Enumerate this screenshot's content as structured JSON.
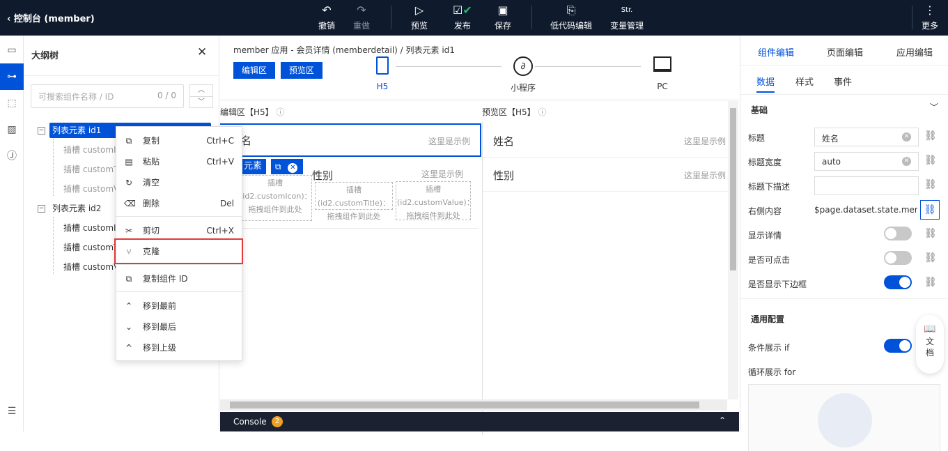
{
  "topbar": {
    "back_label": "控制台 (member)",
    "actions": [
      {
        "label": "撤销",
        "icon": "↶"
      },
      {
        "label": "重做",
        "icon": "↷"
      },
      {
        "label": "预览",
        "icon": "▷"
      },
      {
        "label": "发布",
        "icon": "☑"
      },
      {
        "label": "保存",
        "icon": "💾"
      },
      {
        "label": "低代码编辑",
        "icon": "⎘"
      },
      {
        "label": "变量管理",
        "icon": "Str."
      },
      {
        "label": "更多",
        "icon": "⋮"
      }
    ]
  },
  "outline": {
    "title": "大纲树",
    "search_placeholder": "可搜索组件名称 / ID",
    "search_count": "0 / 0",
    "nodes": [
      {
        "label": "列表元素 id1",
        "children": [
          "插槽 customIc",
          "插槽 customTi",
          "插槽 customVa"
        ]
      },
      {
        "label": "列表元素 id2",
        "children": [
          "插槽 customIc",
          "插槽 customTi",
          "插槽 customVa"
        ]
      }
    ]
  },
  "context_menu": {
    "items": [
      {
        "label": "复制",
        "shortcut": "Ctrl+C",
        "icon": "⧉"
      },
      {
        "label": "粘贴",
        "shortcut": "Ctrl+V",
        "icon": "📋"
      },
      {
        "label": "清空",
        "shortcut": "",
        "icon": "↻"
      },
      {
        "label": "删除",
        "shortcut": "Del",
        "icon": "⌫"
      },
      {
        "label": "剪切",
        "shortcut": "Ctrl+X",
        "icon": "✂"
      },
      {
        "label": "克隆",
        "shortcut": "",
        "icon": "⑂"
      },
      {
        "label": "复制组件 ID",
        "shortcut": "",
        "icon": "⧉"
      },
      {
        "label": "移到最前",
        "shortcut": "",
        "icon": "⌃"
      },
      {
        "label": "移到最后",
        "shortcut": "",
        "icon": "⌄"
      },
      {
        "label": "移到上级",
        "shortcut": "",
        "icon": "^"
      }
    ]
  },
  "center": {
    "breadcrumb": "member 应用 - 会员详情 (memberdetail)   /   列表元素 id1",
    "edit_btn": "编辑区",
    "preview_btn": "预览区",
    "devices": [
      "H5",
      "小程序",
      "PC"
    ],
    "edit_area_title": "编辑区【H5】",
    "preview_area_title": "预览区【H5】",
    "edit_row1_label": "名",
    "edit_row1_hint": "这里是示例",
    "edit_row2_label": "性别",
    "edit_row2_hint": "这里是示例",
    "selected_tag": "元素",
    "slot1": "插槽 (id2.customIcon)：拖拽组件到此处",
    "slot2": "插槽(id2.customTitle)：拖拽组件到此处",
    "slot3": "插槽 (id2.customValue)：拖拽组件到此处",
    "preview_row1_label": "姓名",
    "preview_row1_hint": "这里是示例",
    "preview_row2_label": "性别",
    "preview_row2_hint": "这里是示例",
    "console_label": "Console",
    "console_badge": "2"
  },
  "right": {
    "tabs": [
      "组件编辑",
      "页面编辑",
      "应用编辑"
    ],
    "subtabs": [
      "数据",
      "样式",
      "事件"
    ],
    "section_basic": "基础",
    "props": [
      {
        "label": "标题",
        "value": "姓名"
      },
      {
        "label": "标题宽度",
        "value": "auto"
      },
      {
        "label": "标题下描述",
        "value": ""
      },
      {
        "label": "右侧内容",
        "value": "$page.dataset.state.memb..."
      }
    ],
    "toggles": [
      {
        "label": "显示详情",
        "on": false
      },
      {
        "label": "是否可点击",
        "on": false
      },
      {
        "label": "是否显示下边框",
        "on": true
      }
    ],
    "section_general": "通用配置",
    "cond_label": "条件展示 if",
    "loop_label": "循环展示 for",
    "doc_label": "文档"
  },
  "colors": {
    "accent": "#0052d9",
    "topbar": "#0f1a2c",
    "highlight": "#e03a3a"
  }
}
